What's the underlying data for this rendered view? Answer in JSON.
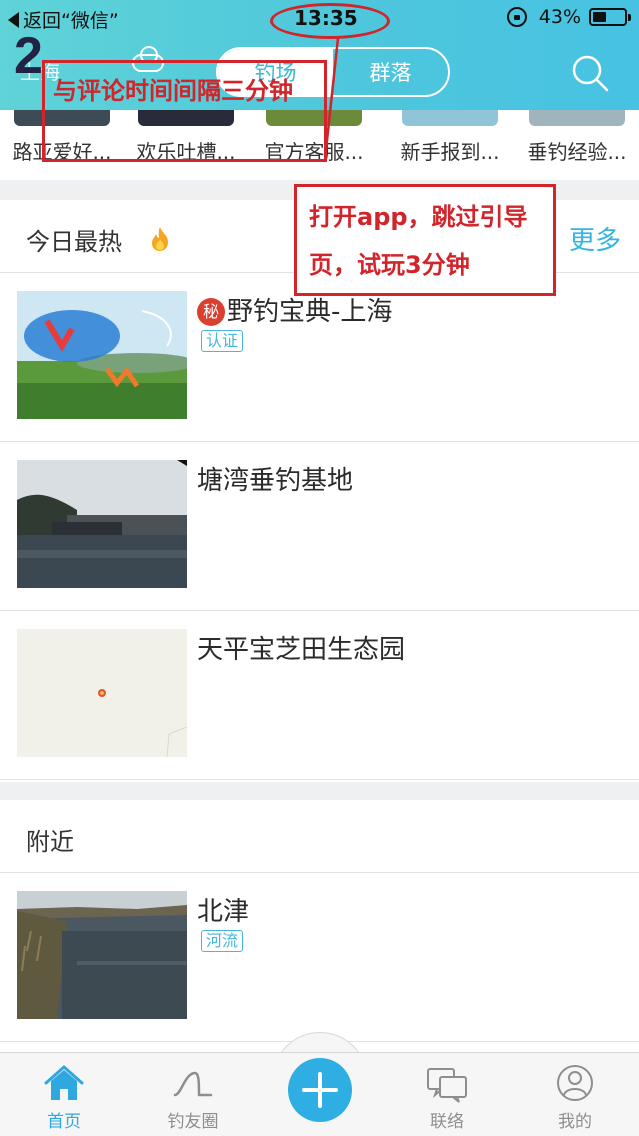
{
  "status_bar": {
    "back_label": "返回“微信”",
    "time": "13:35",
    "battery_text": "43%",
    "battery_level": 0.43
  },
  "nav": {
    "left_label": "上海",
    "tabs": [
      {
        "label": "钓场",
        "active": true
      },
      {
        "label": "群落",
        "active": false
      }
    ],
    "icons": [
      "cloud-icon",
      "search-icon"
    ]
  },
  "circles": [
    {
      "label": "路亚爱好...",
      "color": "#3c4b56"
    },
    {
      "label": "欢乐吐槽...",
      "color": "#2a2b3a"
    },
    {
      "label": "官方客服...",
      "color": "#6b8a3a"
    },
    {
      "label": "新手报到...",
      "color": "#8fc5d6"
    },
    {
      "label": "垂钓经验...",
      "color": "#9fb4bc"
    }
  ],
  "hot_section": {
    "title": "今日最热",
    "more_label": "更多",
    "items": [
      {
        "badge": "秘",
        "title": "野钓宝典-上海",
        "tag": "认证"
      },
      {
        "badge": "",
        "title": "塘湾垂钓基地",
        "tag": ""
      },
      {
        "badge": "",
        "title": "天平宝芝田生态园",
        "tag": ""
      }
    ]
  },
  "nearby_section": {
    "title": "附近",
    "items": [
      {
        "title": "北津",
        "tag": "河流"
      }
    ]
  },
  "tabbar": {
    "tabs": [
      {
        "label": "首页",
        "icon": "home-icon",
        "active": true
      },
      {
        "label": "钓友圈",
        "icon": "friends-circle-icon",
        "active": false
      },
      {
        "label": "联络",
        "icon": "chat-icon",
        "active": false
      },
      {
        "label": "我的",
        "icon": "profile-icon",
        "active": false
      }
    ],
    "fab_icon": "plus-icon"
  },
  "annotations": {
    "step_number": "2",
    "note_top": "与评论时间间隔三分钟",
    "note_right": "打开app，跳过引导页，试玩3分钟",
    "color": "#d1242b"
  }
}
